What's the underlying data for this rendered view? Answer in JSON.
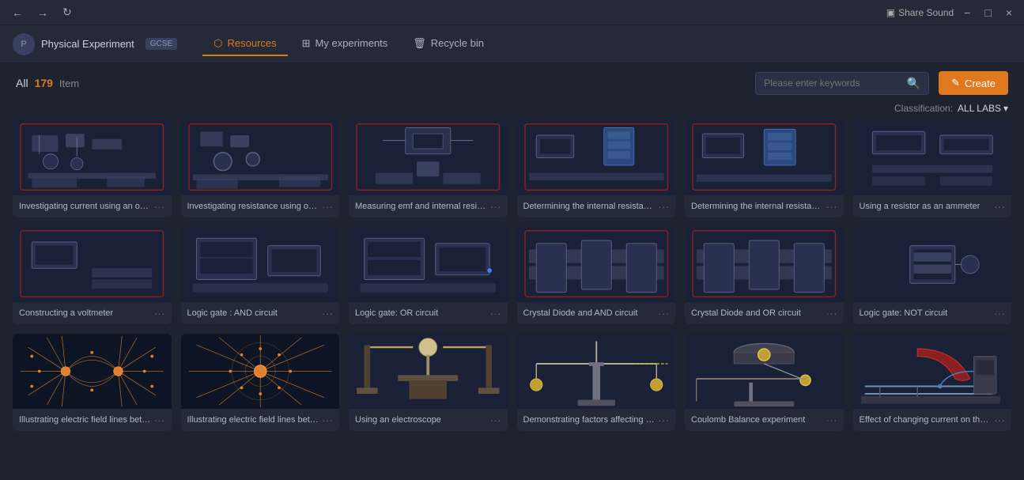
{
  "titleBar": {
    "shareSound": "Share Sound",
    "minimize": "−",
    "maximize": "□",
    "close": "×",
    "backArrow": "←",
    "forwardArrow": "→",
    "refresh": "↻"
  },
  "appHeader": {
    "appName": "Physical Experiment",
    "badge": "GCSE",
    "avatarText": "P"
  },
  "nav": {
    "tabs": [
      {
        "id": "resources",
        "label": "Resources",
        "active": true
      },
      {
        "id": "my-experiments",
        "label": "My experiments",
        "active": false
      },
      {
        "id": "recycle-bin",
        "label": "Recycle bin",
        "active": false
      }
    ]
  },
  "toolbar": {
    "allLabel": "All",
    "count": "179",
    "itemLabel": "Item",
    "searchPlaceholder": "Please enter keywords",
    "createLabel": "Create",
    "classificationLabel": "Classification:",
    "allLabsLabel": "ALL LABS"
  },
  "cards": [
    {
      "id": 1,
      "title": "Investigating current using an oh...",
      "type": "circuit1"
    },
    {
      "id": 2,
      "title": "Investigating resistance using ohm...",
      "type": "circuit2"
    },
    {
      "id": 3,
      "title": "Measuring emf and internal resista...",
      "type": "circuit3"
    },
    {
      "id": 4,
      "title": "Determining the internal resistanc...",
      "type": "circuit4"
    },
    {
      "id": 5,
      "title": "Determining the internal resistanc...",
      "type": "circuit5"
    },
    {
      "id": 6,
      "title": "Using a resistor as an ammeter",
      "type": "circuit6"
    },
    {
      "id": 7,
      "title": "Constructing a voltmeter",
      "type": "circuit7"
    },
    {
      "id": 8,
      "title": "Logic gate : AND circuit",
      "type": "circuit8"
    },
    {
      "id": 9,
      "title": "Logic gate: OR circuit",
      "type": "circuit9"
    },
    {
      "id": 10,
      "title": "Crystal Diode and AND circuit",
      "type": "circuit10"
    },
    {
      "id": 11,
      "title": "Crystal Diode and OR circuit",
      "type": "circuit11"
    },
    {
      "id": 12,
      "title": "Logic gate: NOT circuit",
      "type": "circuit12"
    },
    {
      "id": 13,
      "title": "Illustrating electric field lines betw...",
      "type": "field1"
    },
    {
      "id": 14,
      "title": "Illustrating electric field lines betw...",
      "type": "field2"
    },
    {
      "id": 15,
      "title": "Using an electroscope",
      "type": "electroscope"
    },
    {
      "id": 16,
      "title": "Demonstrating factors affecting C...",
      "type": "demo"
    },
    {
      "id": 17,
      "title": "Coulomb Balance experiment",
      "type": "coulomb"
    },
    {
      "id": 18,
      "title": "Effect of changing current on the ...",
      "type": "effect"
    }
  ]
}
